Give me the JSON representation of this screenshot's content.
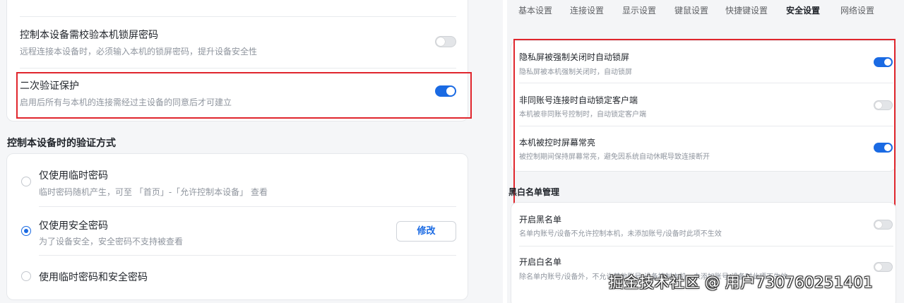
{
  "left": {
    "lock_password_row": {
      "title": "控制本设备需校验本机锁屏密码",
      "desc": "远程连接本设备时，必须输入本机的锁屏密码，提升设备安全性",
      "enabled": false
    },
    "two_factor_row": {
      "title": "二次验证保护",
      "desc": "启用后所有与本机的连接需经过主设备的同意后才可建立",
      "enabled": true
    },
    "verify_method": {
      "heading": "控制本设备时的验证方式",
      "options": [
        {
          "title": "仅使用临时密码",
          "desc": "临时密码随机产生，可至 「首页」-「允许控制本设备」 查看",
          "selected": false
        },
        {
          "title": "仅使用安全密码",
          "desc": "为了设备安全，安全密码不支持被查看",
          "selected": true
        },
        {
          "title": "使用临时密码和安全密码",
          "selected": false
        }
      ],
      "edit_label": "修改"
    }
  },
  "right": {
    "tabs": [
      {
        "label": "基本设置",
        "active": false
      },
      {
        "label": "连接设置",
        "active": false
      },
      {
        "label": "显示设置",
        "active": false
      },
      {
        "label": "键鼠设置",
        "active": false
      },
      {
        "label": "快捷键设置",
        "active": false
      },
      {
        "label": "安全设置",
        "active": true
      },
      {
        "label": "网络设置",
        "active": false
      }
    ],
    "security_rows": [
      {
        "title": "隐私屏被强制关闭时自动锁屏",
        "desc": "隐私屏被本机强制关闭时，自动锁屏",
        "enabled": true
      },
      {
        "title": "非同账号连接时自动锁定客户端",
        "desc": "本机被非同账号控制时，自动锁定客户端",
        "enabled": false
      },
      {
        "title": "本机被控时屏幕常亮",
        "desc": "被控制期间保持屏幕常亮，避免因系统自动休眠导致连接断开",
        "enabled": true
      }
    ],
    "list_heading": "黑白名单管理",
    "list_rows": [
      {
        "title": "开启黑名单",
        "desc": "名单内账号/设备不允许控制本机，未添加账号/设备时此项不生效",
        "enabled": false
      },
      {
        "title": "开启白名单",
        "desc": "除名单内账号/设备外，不允许其他账号/设备控制本机，未添加账号/设备时此项不生效",
        "enabled": false
      }
    ]
  },
  "watermark": "掘金技术社区 @ 用户730760251401",
  "colors": {
    "accent": "#1a6ae3",
    "highlight_box": "#e0262d"
  }
}
